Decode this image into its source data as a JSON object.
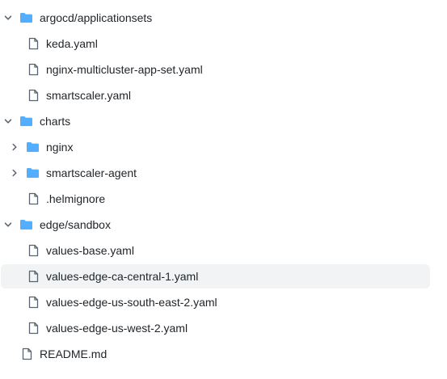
{
  "tree": {
    "items": [
      {
        "label": "argocd/applicationsets",
        "type": "folder",
        "expanded": true,
        "icon": "folder-icon"
      },
      {
        "label": "keda.yaml",
        "type": "file",
        "icon": "file-icon"
      },
      {
        "label": "nginx-multicluster-app-set.yaml",
        "type": "file",
        "icon": "file-icon"
      },
      {
        "label": "smartscaler.yaml",
        "type": "file",
        "icon": "file-icon"
      },
      {
        "label": "charts",
        "type": "folder",
        "expanded": true,
        "icon": "folder-icon"
      },
      {
        "label": "nginx",
        "type": "folder",
        "expanded": false,
        "icon": "folder-icon"
      },
      {
        "label": "smartscaler-agent",
        "type": "folder",
        "expanded": false,
        "icon": "folder-icon"
      },
      {
        "label": ".helmignore",
        "type": "file",
        "icon": "file-icon"
      },
      {
        "label": "edge/sandbox",
        "type": "folder",
        "expanded": true,
        "icon": "folder-icon"
      },
      {
        "label": "values-base.yaml",
        "type": "file",
        "icon": "file-icon"
      },
      {
        "label": "values-edge-ca-central-1.yaml",
        "type": "file",
        "icon": "file-icon",
        "hovered": true
      },
      {
        "label": "values-edge-us-south-east-2.yaml",
        "type": "file",
        "icon": "file-icon"
      },
      {
        "label": "values-edge-us-west-2.yaml",
        "type": "file",
        "icon": "file-icon"
      },
      {
        "label": "README.md",
        "type": "file",
        "icon": "file-icon"
      }
    ]
  },
  "colors": {
    "folder": "#54aeff",
    "icon_stroke": "#59636e",
    "text": "#1f2328",
    "hover_bg": "#f1f3f4"
  }
}
